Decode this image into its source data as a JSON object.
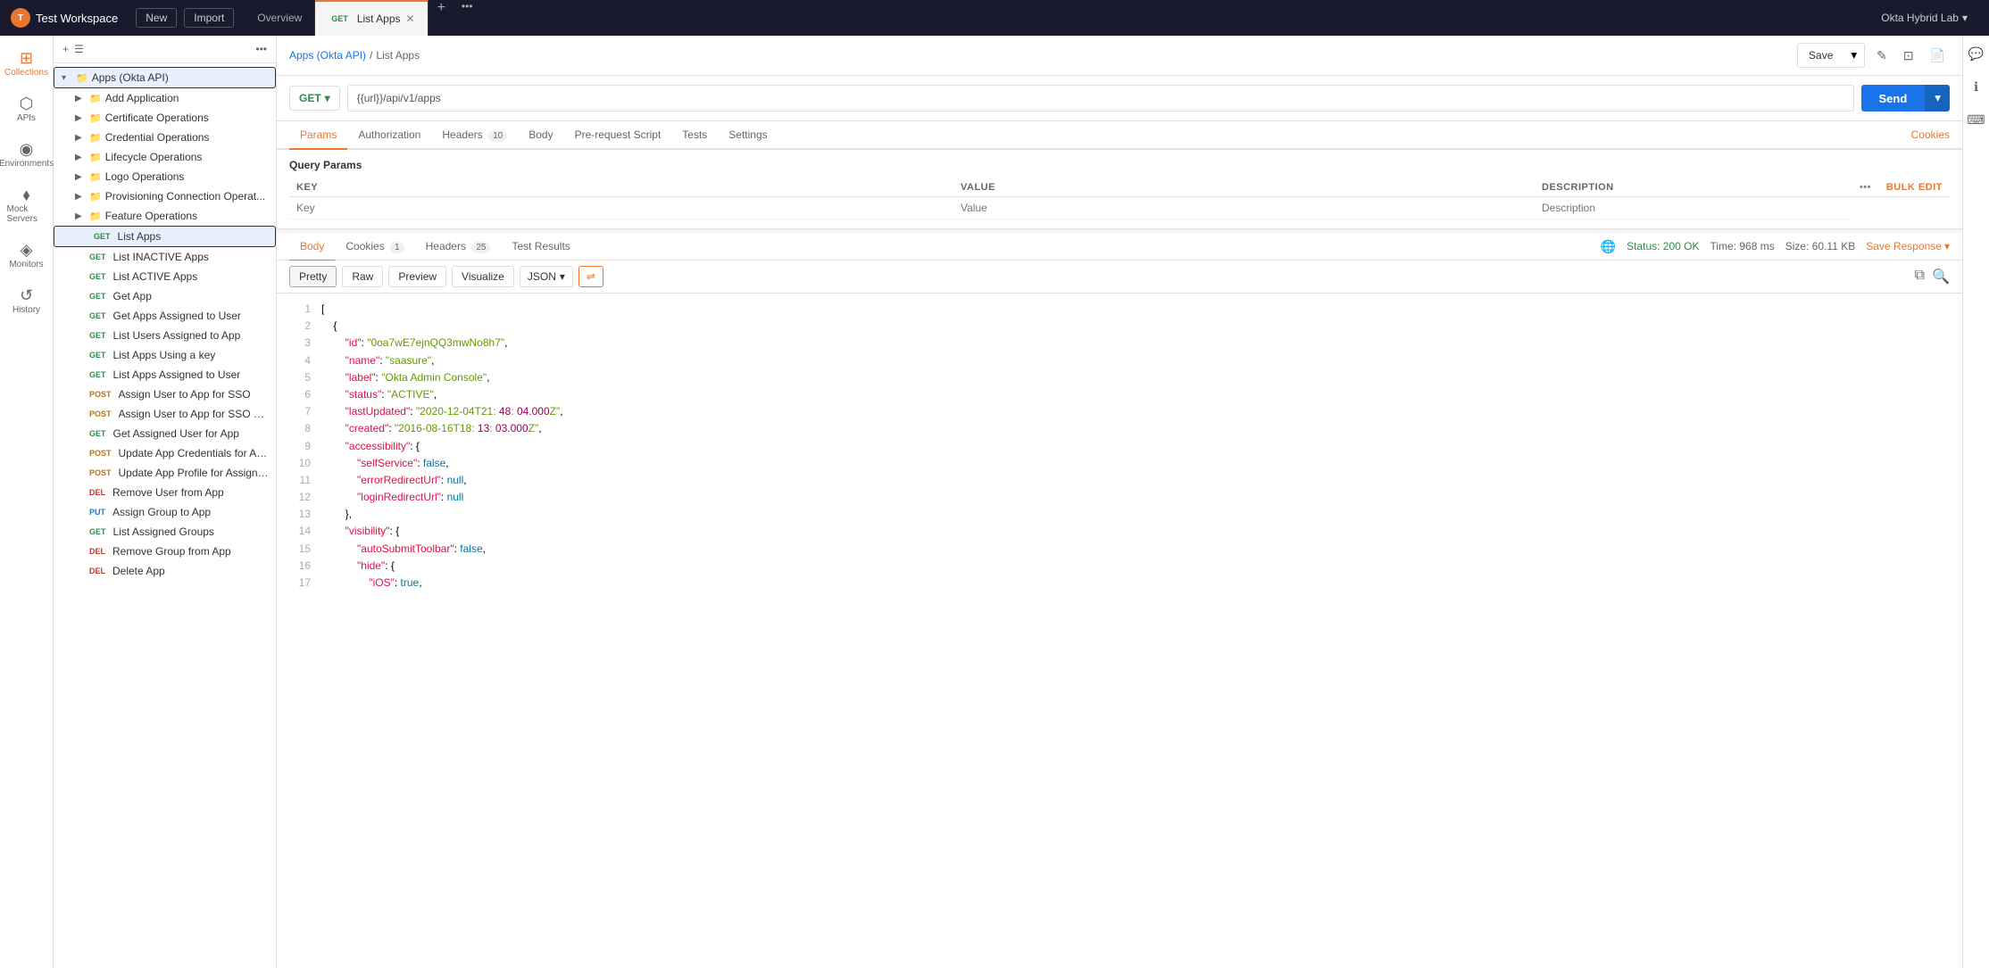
{
  "app": {
    "title": "Test Workspace",
    "logo_text": "T"
  },
  "topbar": {
    "new_label": "New",
    "import_label": "Import",
    "workspace_name": "Okta Hybrid Lab",
    "overview_tab": "Overview",
    "active_tab_method": "GET",
    "active_tab_label": "List Apps"
  },
  "nav": {
    "collections_label": "Collections",
    "apis_label": "APIs",
    "environments_label": "Environments",
    "mock_servers_label": "Mock Servers",
    "monitors_label": "Monitors",
    "history_label": "History"
  },
  "sidebar": {
    "collection_name": "Apps (Okta API)",
    "items": [
      {
        "label": "Add Application",
        "type": "folder",
        "level": 1
      },
      {
        "label": "Certificate Operations",
        "type": "folder",
        "level": 1
      },
      {
        "label": "Credential Operations",
        "type": "folder",
        "level": 1
      },
      {
        "label": "Lifecycle Operations",
        "type": "folder",
        "level": 1
      },
      {
        "label": "Logo Operations",
        "type": "folder",
        "level": 1
      },
      {
        "label": "Provisioning Connection Operat...",
        "type": "folder",
        "level": 1
      },
      {
        "label": "Feature Operations",
        "type": "folder",
        "level": 1
      },
      {
        "label": "List Apps",
        "type": "request",
        "method": "GET",
        "level": 1,
        "active": true
      },
      {
        "label": "List INACTIVE Apps",
        "type": "request",
        "method": "GET",
        "level": 2
      },
      {
        "label": "List ACTIVE Apps",
        "type": "request",
        "method": "GET",
        "level": 2
      },
      {
        "label": "Get App",
        "type": "request",
        "method": "GET",
        "level": 2
      },
      {
        "label": "Get Apps Assigned to User",
        "type": "request",
        "method": "GET",
        "level": 2
      },
      {
        "label": "List Users Assigned to App",
        "type": "request",
        "method": "GET",
        "level": 2
      },
      {
        "label": "List Apps Using a key",
        "type": "request",
        "method": "GET",
        "level": 2
      },
      {
        "label": "List Apps Assigned to User",
        "type": "request",
        "method": "GET",
        "level": 2
      },
      {
        "label": "Assign User to App for SSO",
        "type": "request",
        "method": "POST",
        "level": 2
      },
      {
        "label": "Assign User to App for SSO & P...",
        "type": "request",
        "method": "POST",
        "level": 2
      },
      {
        "label": "Get Assigned User for App",
        "type": "request",
        "method": "GET",
        "level": 2
      },
      {
        "label": "Update App Credentials for Ass...",
        "type": "request",
        "method": "POST",
        "level": 2
      },
      {
        "label": "Update App Profile for Assigne...",
        "type": "request",
        "method": "POST",
        "level": 2
      },
      {
        "label": "Remove User from App",
        "type": "request",
        "method": "DEL",
        "level": 2
      },
      {
        "label": "Assign Group to App",
        "type": "request",
        "method": "PUT",
        "level": 2
      },
      {
        "label": "List Assigned Groups",
        "type": "request",
        "method": "GET",
        "level": 2
      },
      {
        "label": "Remove Group from App",
        "type": "request",
        "method": "DEL",
        "level": 2
      },
      {
        "label": "Delete App",
        "type": "request",
        "method": "DEL",
        "level": 2
      }
    ]
  },
  "request": {
    "method": "GET",
    "url": "{{url}}/api/v1/apps",
    "tabs": [
      "Params",
      "Authorization",
      "Headers (10)",
      "Body",
      "Pre-request Script",
      "Tests",
      "Settings"
    ],
    "active_tab": "Params",
    "query_params_title": "Query Params",
    "col_key": "KEY",
    "col_value": "VALUE",
    "col_desc": "DESCRIPTION",
    "bulk_edit": "Bulk Edit",
    "key_placeholder": "Key",
    "value_placeholder": "Value",
    "desc_placeholder": "Description",
    "cookies_label": "Cookies",
    "save_label": "Save",
    "send_label": "Send"
  },
  "breadcrumb": {
    "collection": "Apps (Okta API)",
    "separator": "/",
    "current": "List Apps"
  },
  "response": {
    "tabs": [
      "Body",
      "Cookies (1)",
      "Headers (25)",
      "Test Results"
    ],
    "active_tab": "Body",
    "status": "200 OK",
    "time": "968 ms",
    "size": "60.11 KB",
    "save_response": "Save Response",
    "views": [
      "Pretty",
      "Raw",
      "Preview",
      "Visualize"
    ],
    "active_view": "Pretty",
    "format": "JSON",
    "lines": [
      {
        "num": 1,
        "content": "["
      },
      {
        "num": 2,
        "content": "    {"
      },
      {
        "num": 3,
        "content": "        \"id\": \"0oa7wE7ejnQQ3mwNo8h7\","
      },
      {
        "num": 4,
        "content": "        \"name\": \"saasure\","
      },
      {
        "num": 5,
        "content": "        \"label\": \"Okta Admin Console\","
      },
      {
        "num": 6,
        "content": "        \"status\": \"ACTIVE\","
      },
      {
        "num": 7,
        "content": "        \"lastUpdated\": \"2020-12-04T21:48:04.000Z\","
      },
      {
        "num": 8,
        "content": "        \"created\": \"2016-08-16T18:13:03.000Z\","
      },
      {
        "num": 9,
        "content": "        \"accessibility\": {"
      },
      {
        "num": 10,
        "content": "            \"selfService\": false,"
      },
      {
        "num": 11,
        "content": "            \"errorRedirectUrl\": null,"
      },
      {
        "num": 12,
        "content": "            \"loginRedirectUrl\": null"
      },
      {
        "num": 13,
        "content": "        },"
      },
      {
        "num": 14,
        "content": "        \"visibility\": {"
      },
      {
        "num": 15,
        "content": "            \"autoSubmitToolbar\": false,"
      },
      {
        "num": 16,
        "content": "            \"hide\": {"
      },
      {
        "num": 17,
        "content": "                \"iOS\": true,"
      }
    ]
  }
}
